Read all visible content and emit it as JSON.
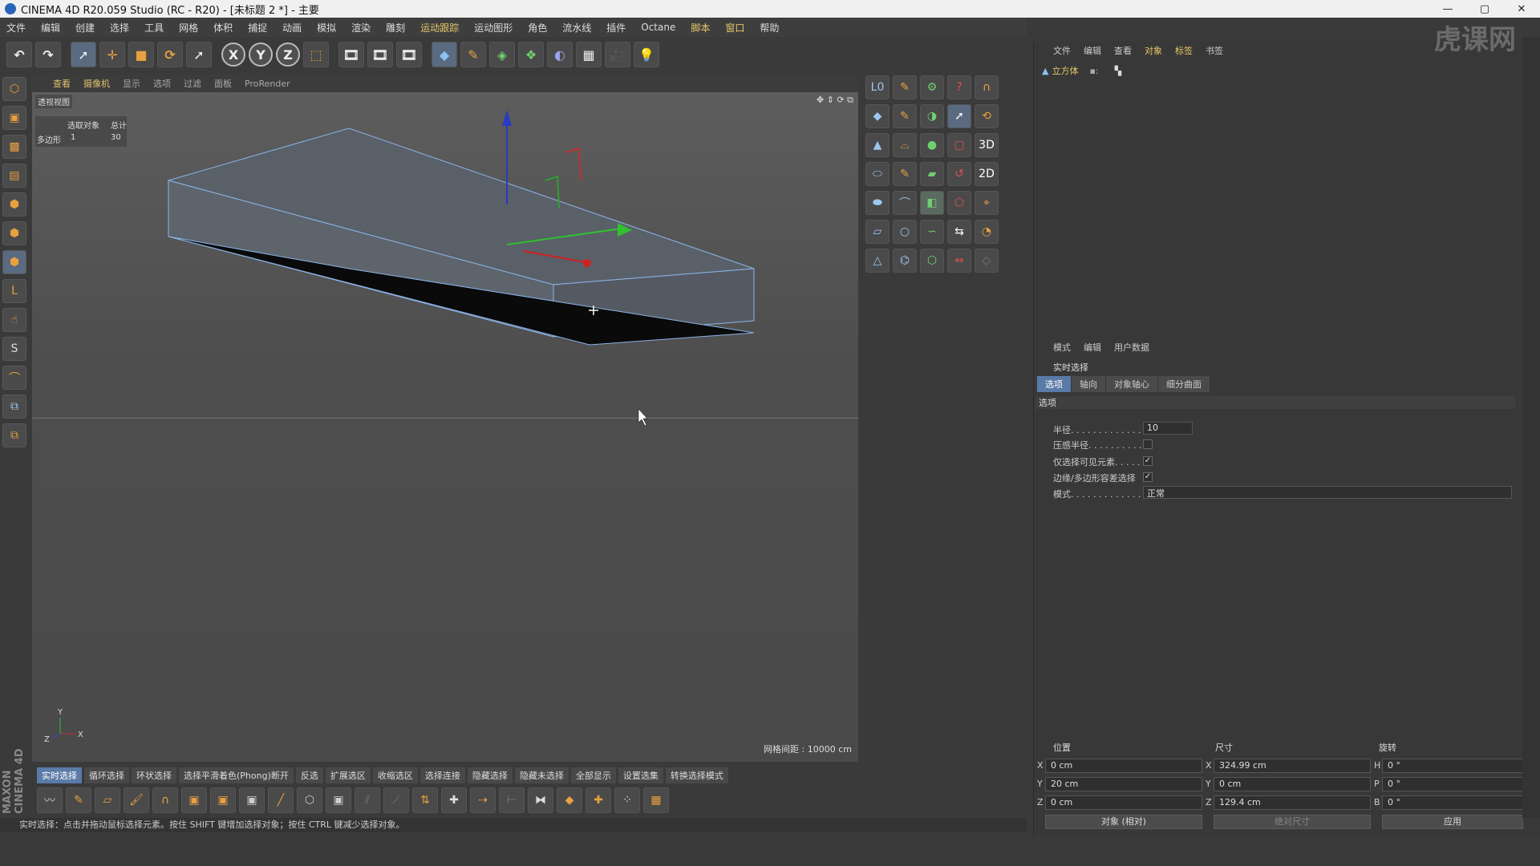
{
  "window": {
    "title": "CINEMA 4D R20.059 Studio (RC - R20) - [未标题 2 *] - 主要",
    "controls": [
      "—",
      "▢",
      "✕"
    ]
  },
  "menu": [
    "文件",
    "编辑",
    "创建",
    "选择",
    "工具",
    "网格",
    "体积",
    "捕捉",
    "动画",
    "模拟",
    "渲染",
    "雕刻",
    "运动跟踪",
    "运动图形",
    "角色",
    "流水线",
    "插件",
    "Octane",
    "脚本",
    "窗口",
    "帮助"
  ],
  "toolbar": {
    "undo": "↶",
    "redo": "↷",
    "x_axis": "X",
    "y_axis": "Y",
    "z_axis": "Z"
  },
  "viewport": {
    "tabs": [
      "查看",
      "摄像机",
      "显示",
      "选项",
      "过滤",
      "面板",
      "ProRender"
    ],
    "label": "透视视图",
    "hud": {
      "col1": "选取对象",
      "col2": "总计",
      "row_label": "多边形",
      "selected": "1",
      "total": "30"
    },
    "grid_spacing": "网格间距 : 10000 cm",
    "axis_y": "Y",
    "axis_z": "Z",
    "axis_x": "X"
  },
  "object_manager": {
    "tabs": [
      "文件",
      "编辑",
      "查看",
      "对象",
      "标签",
      "书签"
    ],
    "object_name": "立方体"
  },
  "attributes": {
    "tabs": [
      "模式",
      "编辑",
      "用户数据"
    ],
    "title": "实时选择",
    "subtabs": [
      "选项",
      "轴向",
      "对象轴心",
      "细分曲面"
    ],
    "section": "选项",
    "radius_label": "半径. . . . . . . . . . . . . . .",
    "radius_value": "10",
    "pressure_label": "压感半径. . . . . . . . . . . .",
    "visible_only_label": "仅选择可见元素. . . . . . .",
    "edge_label": "边缘/多边形容差选择",
    "mode_label": "模式. . . . . . . . . . . . . . .",
    "mode_value": "正常",
    "visible_only_checked": "✓",
    "edge_checked": "✓"
  },
  "coordinates": {
    "position_header": "位置",
    "size_header": "尺寸",
    "rotation_header": "旋转",
    "pos": [
      "0 cm",
      "20 cm",
      "0 cm"
    ],
    "size": [
      "324.99 cm",
      "0 cm",
      "129.4 cm"
    ],
    "rot": [
      "0 °",
      "0 °",
      "0 °"
    ],
    "axis_labels_pos": [
      "X",
      "Y",
      "Z"
    ],
    "rot_labels": [
      "H",
      "P",
      "B"
    ],
    "object_mode": "对象 (相对)",
    "size_mode": "绝对尺寸",
    "apply": "应用"
  },
  "mode_bar": [
    "实时选择",
    "循环选择",
    "环状选择",
    "选择平滑着色(Phong)断开",
    "反选",
    "扩展选区",
    "收缩选区",
    "选择连接",
    "隐藏选择",
    "隐藏未选择",
    "全部显示",
    "设置选集",
    "转换选择模式"
  ],
  "status": "实时选择：点击并拖动鼠标选择元素。按住 SHIFT 键增加选择对象；按住 CTRL 键减少选择对象。",
  "brand": "MAXON CINEMA 4D",
  "watermark": "虎课网",
  "colors": {
    "accent": "#e8c86a",
    "selection_blue": "#5a7aa8",
    "orange_icon": "#e8a040"
  }
}
